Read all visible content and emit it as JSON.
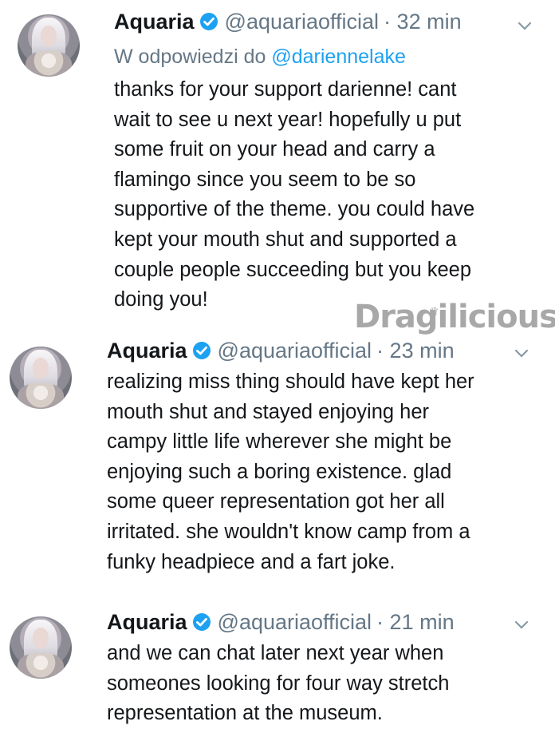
{
  "tweets": [
    {
      "name": "Aquaria",
      "handle": "@aquariaofficial",
      "time": "· 32 min",
      "reply_prefix": "W odpowiedzi do",
      "reply_to": "@dariennelake",
      "text": "thanks for your support darienne! cant\nwait to see u next year! hopefully u put\nsome fruit on your head and carry a\nflamingo since you seem to be so\nsupportive of the theme. you could have\nkept your mouth shut and supported a\ncouple people succeeding but you keep\ndoing you!"
    },
    {
      "name": "Aquaria",
      "handle": "@aquariaofficial",
      "time": "· 23 min",
      "text": "realizing miss thing should have kept her\nmouth shut and stayed enjoying her\ncampy little life wherever she might be\nenjoying such a boring existence. glad\nsome queer representation got her all\nirritated. she wouldn't know camp from a\nfunky headpiece and a fart joke."
    },
    {
      "name": "Aquaria",
      "handle": "@aquariaofficial",
      "time": "· 21 min",
      "text": "and we can chat later next year when\nsomeones looking for four way stretch\nrepresentation at the museum."
    }
  ],
  "watermark": "Dragilicious",
  "icons": {
    "verified": "verified-badge-icon",
    "more": "chevron-down-icon",
    "watermark_crown": "crown-icon"
  },
  "colors": {
    "text": "#14171a",
    "secondary": "#657786",
    "link": "#1da1f2",
    "verified": "#1da1f2",
    "watermark": "#9a9a9a"
  }
}
